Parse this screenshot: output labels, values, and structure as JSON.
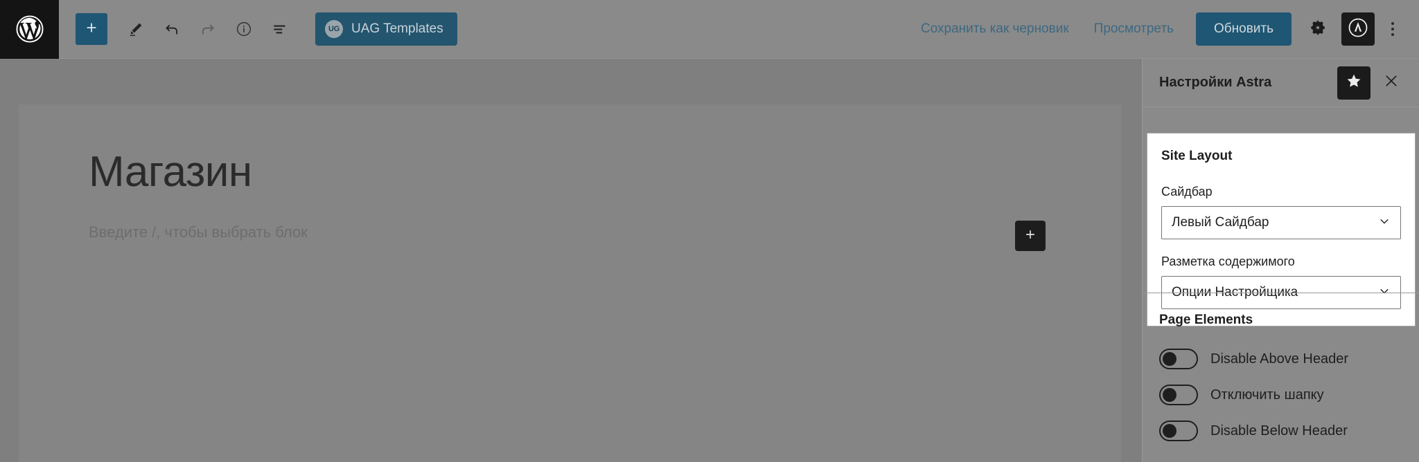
{
  "toolbar": {
    "wp_logo_icon": "wordpress-logo-icon",
    "add_block_label": "+",
    "add_block_icon": "plus-icon",
    "edit_icon": "pencil-icon",
    "undo_icon": "undo-arrow-icon",
    "redo_icon": "redo-arrow-icon",
    "info_icon": "info-circle-icon",
    "list_view_icon": "list-view-icon",
    "uag_badge": "UG",
    "uag_label": "UAG Templates",
    "save_draft_label": "Сохранить как черновик",
    "preview_label": "Просмотреть",
    "update_label": "Обновить",
    "settings_icon": "gear-icon",
    "astra_icon": "astra-logo-icon",
    "options_icon": "kebab-menu-icon",
    "accent_blue": "#1f5673",
    "link_blue": "#3d6880"
  },
  "editor": {
    "post_title": "Магазин",
    "block_placeholder": "Введите /, чтобы выбрать блок",
    "appender_icon": "plus-icon",
    "canvas_bg": "#858585"
  },
  "sidebar": {
    "title": "Настройки Astra",
    "star_icon": "star-icon",
    "close_icon": "close-x-icon",
    "site_layout": {
      "heading": "Site Layout",
      "fields": [
        {
          "label": "Сайдбар",
          "value": "Левый Сайдбар",
          "chevron_icon": "chevron-down-icon"
        },
        {
          "label": "Разметка содержимого",
          "value": "Опции Настройщика",
          "chevron_icon": "chevron-down-icon"
        }
      ]
    },
    "page_elements": {
      "heading": "Page Elements",
      "toggles": [
        {
          "label": "Disable Above Header",
          "on": false
        },
        {
          "label": "Отключить шапку",
          "on": false
        },
        {
          "label": "Disable Below Header",
          "on": false
        }
      ]
    }
  }
}
